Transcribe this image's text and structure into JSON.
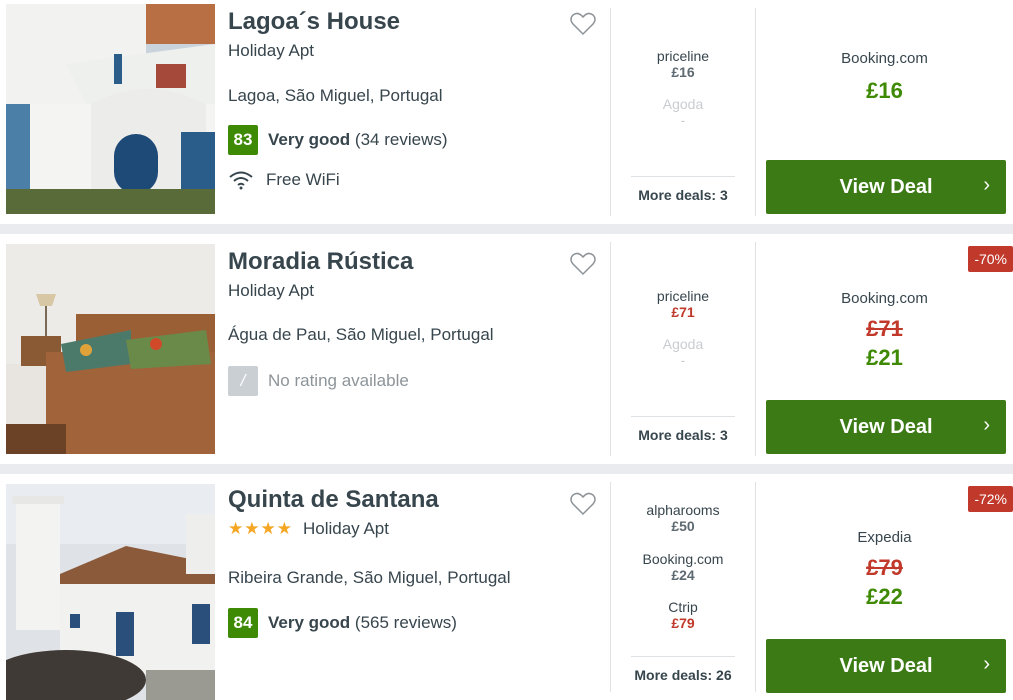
{
  "listings": [
    {
      "name": "Lagoa´s House",
      "type": "Holiday Apt",
      "stars": "",
      "location": "Lagoa, São Miguel, Portugal",
      "score": "83",
      "rating_label": "Very good",
      "reviews": "(34 reviews)",
      "amenity": "Free WiFi",
      "deals": [
        {
          "provider": "priceline",
          "price": "£16"
        },
        {
          "provider": "Agoda",
          "price": "-"
        }
      ],
      "more_deals": "More deals: 3",
      "best_provider": "Booking.com",
      "best_old_price": "",
      "best_price": "£16",
      "discount": "",
      "cta": "View Deal"
    },
    {
      "name": "Moradia Rústica",
      "type": "Holiday Apt",
      "stars": "",
      "location": "Água de Pau, São Miguel, Portugal",
      "score": "/",
      "rating_label": "No rating available",
      "reviews": "",
      "amenity": "",
      "deals": [
        {
          "provider": "priceline",
          "price": "£71"
        },
        {
          "provider": "Agoda",
          "price": "-"
        }
      ],
      "more_deals": "More deals: 3",
      "best_provider": "Booking.com",
      "best_old_price": "£71",
      "best_price": "£21",
      "discount": "-70%",
      "cta": "View Deal"
    },
    {
      "name": "Quinta de Santana",
      "type": "Holiday Apt",
      "stars": "★★★★",
      "location": "Ribeira Grande, São Miguel, Portugal",
      "score": "84",
      "rating_label": "Very good",
      "reviews": "(565 reviews)",
      "amenity": "",
      "deals": [
        {
          "provider": "alpharooms",
          "price": "£50"
        },
        {
          "provider": "Booking.com",
          "price": "£24"
        },
        {
          "provider": "Ctrip",
          "price": "£79"
        }
      ],
      "more_deals": "More deals: 26",
      "best_provider": "Expedia",
      "best_old_price": "£79",
      "best_price": "£22",
      "discount": "-72%",
      "cta": "View Deal"
    }
  ],
  "colors": {
    "green": "#3f8a05",
    "button": "#3b7a14",
    "red": "#c0392b",
    "accent_star": "#f5a623"
  }
}
